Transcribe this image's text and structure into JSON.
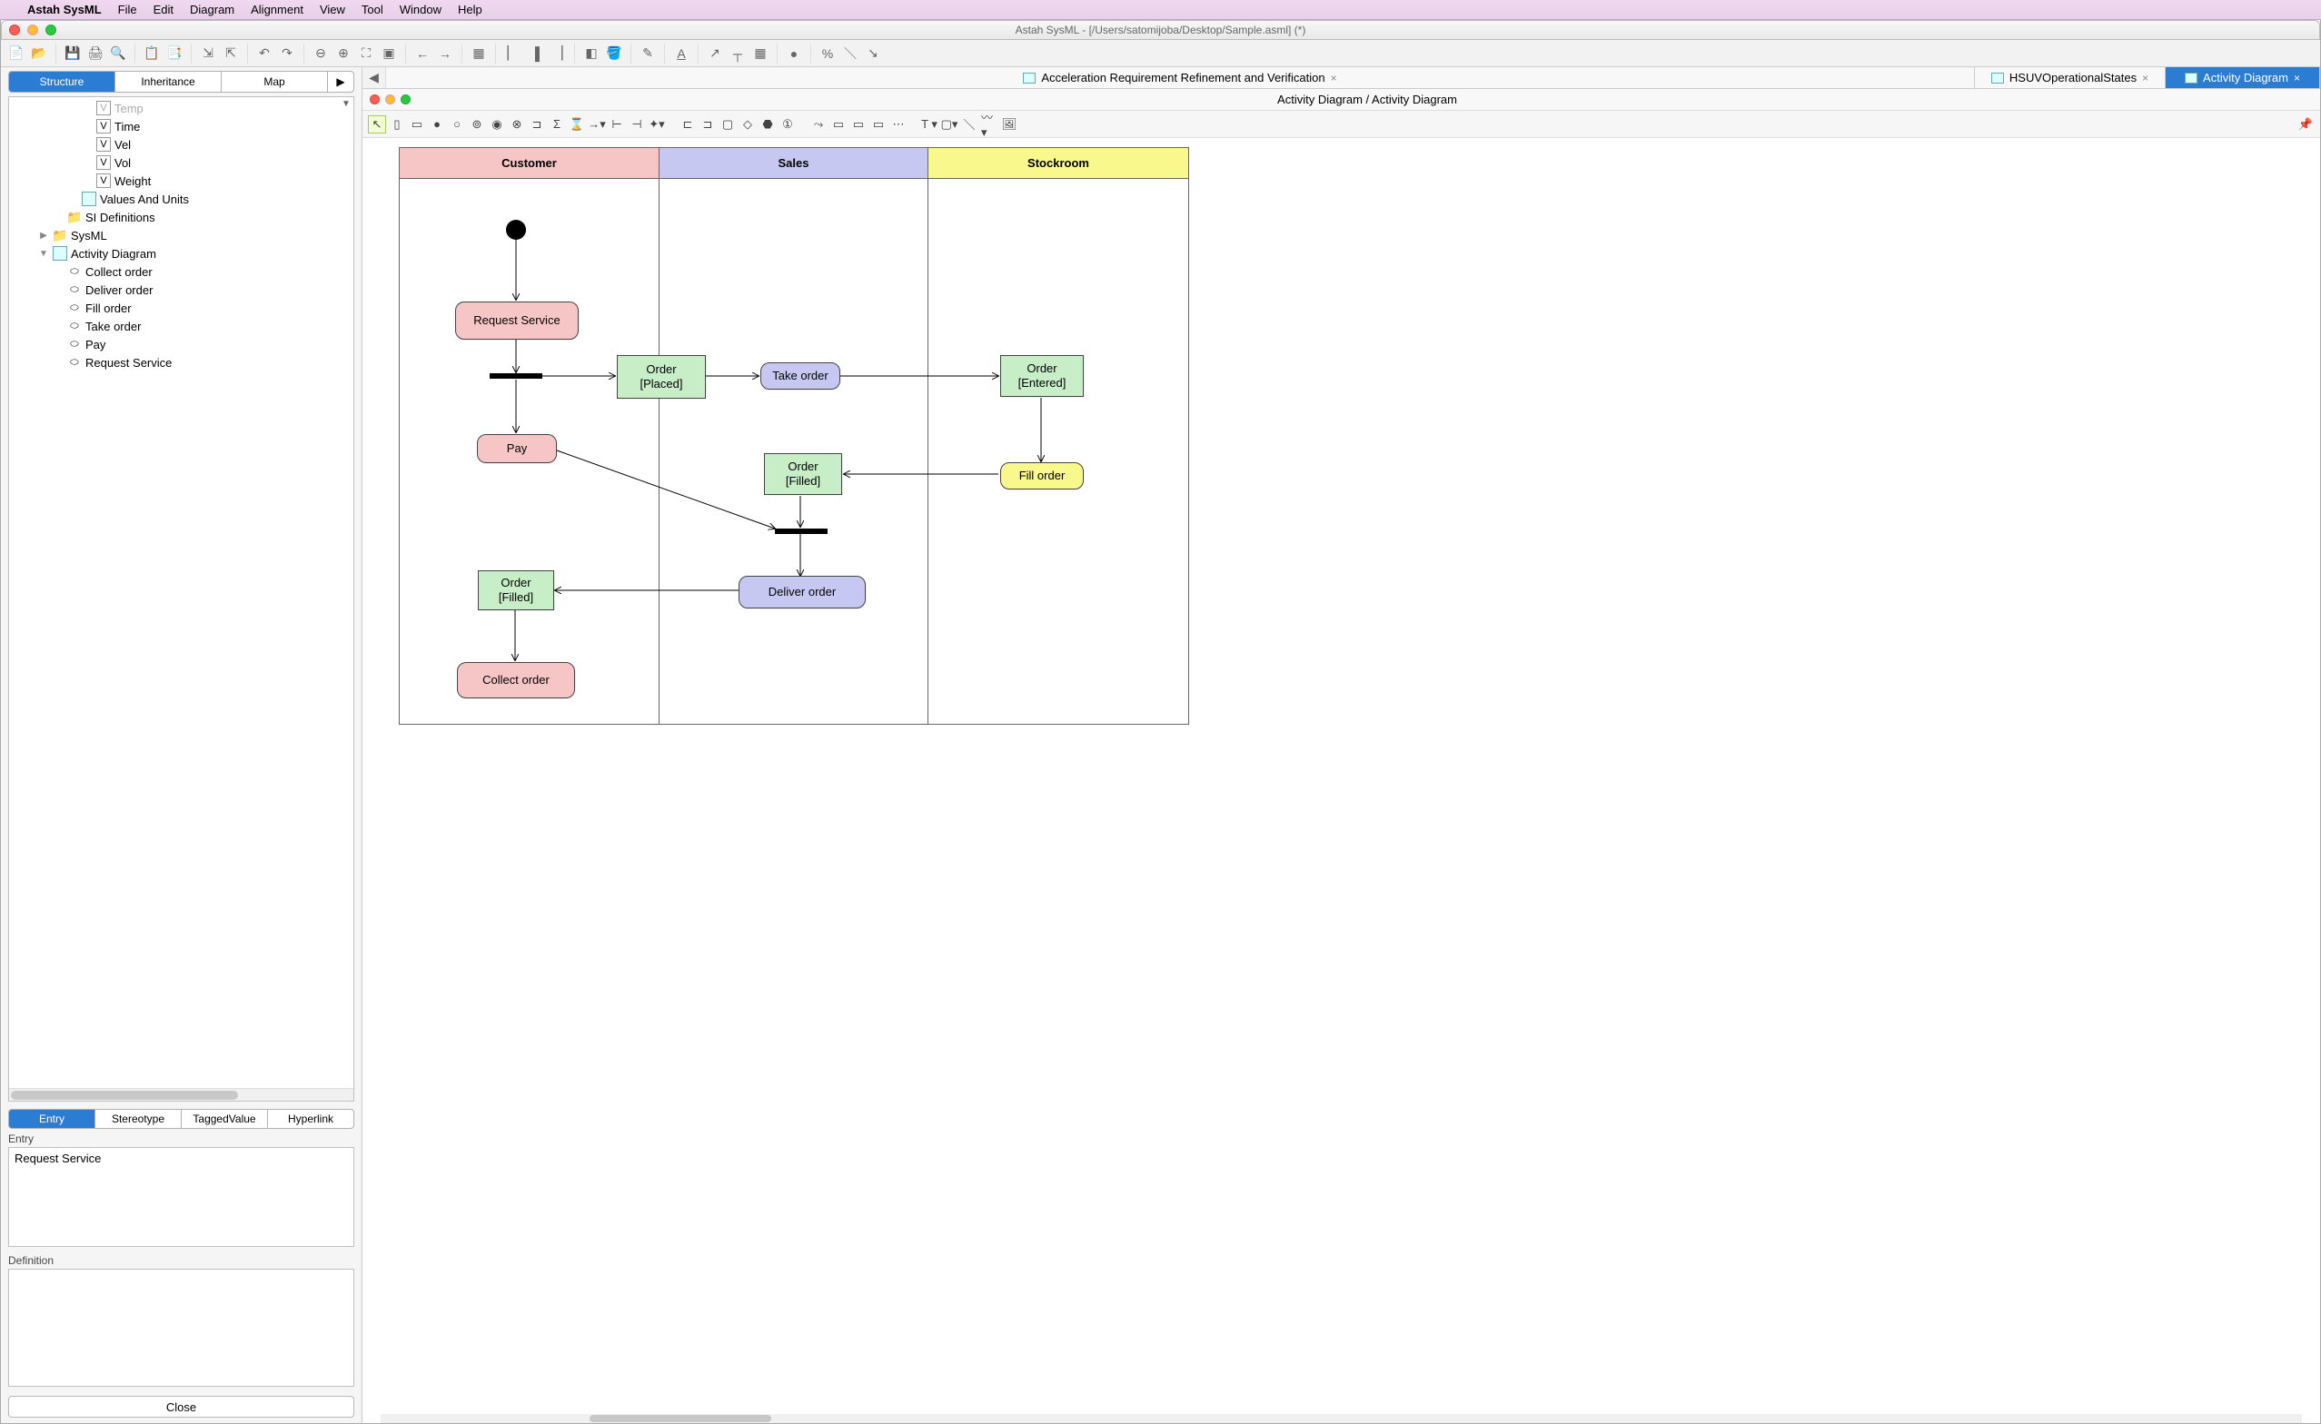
{
  "mac_menu": {
    "app": "Astah SysML",
    "items": [
      "File",
      "Edit",
      "Diagram",
      "Alignment",
      "View",
      "Tool",
      "Window",
      "Help"
    ]
  },
  "window_title": "Astah SysML - [/Users/satomijoba/Desktop/Sample.asml] (*)",
  "left": {
    "tabs": [
      "Structure",
      "Inheritance",
      "Map"
    ],
    "tree": [
      {
        "indent": 5,
        "icon": "V",
        "label": "Temp",
        "faded": true
      },
      {
        "indent": 5,
        "icon": "V",
        "label": "Time"
      },
      {
        "indent": 5,
        "icon": "V",
        "label": "Vel"
      },
      {
        "indent": 5,
        "icon": "V",
        "label": "Vol"
      },
      {
        "indent": 5,
        "icon": "V",
        "label": "Weight"
      },
      {
        "indent": 4,
        "icon": "diag",
        "label": "Values And Units"
      },
      {
        "indent": 3,
        "icon": "folder",
        "label": "SI Definitions"
      },
      {
        "indent": 2,
        "icon": "folder",
        "label": "SysML",
        "tw": "▶"
      },
      {
        "indent": 2,
        "icon": "diag",
        "label": "Activity Diagram",
        "tw": "▼"
      },
      {
        "indent": 3,
        "icon": "act",
        "label": "Collect order"
      },
      {
        "indent": 3,
        "icon": "act",
        "label": "Deliver order"
      },
      {
        "indent": 3,
        "icon": "act",
        "label": "Fill order"
      },
      {
        "indent": 3,
        "icon": "act",
        "label": "Take order"
      },
      {
        "indent": 3,
        "icon": "act",
        "label": "Pay"
      },
      {
        "indent": 3,
        "icon": "act",
        "label": "Request Service"
      }
    ],
    "prop_tabs": [
      "Entry",
      "Stereotype",
      "TaggedValue",
      "Hyperlink"
    ],
    "entry_label": "Entry",
    "entry_value": "Request Service",
    "definition_label": "Definition",
    "definition_value": "",
    "close": "Close"
  },
  "editor": {
    "tabs": [
      {
        "label": "Acceleration Requirement Refinement and Verification",
        "active": false
      },
      {
        "label": "HSUVOperationalStates",
        "active": false
      },
      {
        "label": "Activity Diagram",
        "active": true
      }
    ],
    "inner_title": "Activity Diagram / Activity Diagram",
    "lanes": [
      "Customer",
      "Sales",
      "Stockroom"
    ],
    "nodes": {
      "request_service": "Request Service",
      "order_placed_1": "Order",
      "order_placed_2": "[Placed]",
      "take_order": "Take order",
      "order_entered_1": "Order",
      "order_entered_2": "[Entered]",
      "pay": "Pay",
      "order_filled_s_1": "Order",
      "order_filled_s_2": "[Filled]",
      "fill_order": "Fill order",
      "order_filled_c_1": "Order",
      "order_filled_c_2": "[Filled]",
      "deliver_order": "Deliver order",
      "collect_order": "Collect order"
    }
  }
}
